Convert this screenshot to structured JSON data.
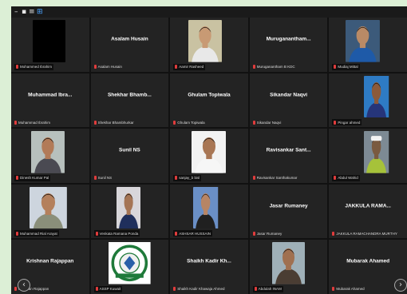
{
  "toolbar": {
    "icons": [
      "minimize-icon",
      "grid-icon",
      "list-icon",
      "gallery-view-icon"
    ]
  },
  "participants": [
    {
      "label": "Mohammed Ibrahim"
    },
    {
      "label": "Asalam Husain",
      "tile_name": "Asalam Husain"
    },
    {
      "label": "Aamir Rasheed"
    },
    {
      "label": "Muruganantham B KDC",
      "tile_name": "Muruganantham..."
    },
    {
      "label": "Mudiaj Mittal"
    },
    {
      "label": "Muhammad Ibrahim",
      "tile_name": "Muhammad Ibra..."
    },
    {
      "label": "Shekhar Bhambhurkar",
      "tile_name": "Shekhar Bhamb..."
    },
    {
      "label": "Ghulam Topiwala",
      "tile_name": "Ghulam Topiwala"
    },
    {
      "label": "Sikandar Naqvi",
      "tile_name": "Sikandar Naqvi"
    },
    {
      "label": "Pingar ahmed"
    },
    {
      "label": "Dinesh Kumar Pal"
    },
    {
      "label": "Sunil NS",
      "tile_name": "Sunil NS"
    },
    {
      "label": "sanjay_b bisl"
    },
    {
      "label": "Ravisankar Santhakumar",
      "tile_name": "Ravisankar Sant..."
    },
    {
      "label": "Abdul Wahid"
    },
    {
      "label": "Muhammad Rial Arayat"
    },
    {
      "label": "Venkata Ramana Ponda"
    },
    {
      "label": "ASHSAR HUSSAIN"
    },
    {
      "label": "Jasar Rumaney",
      "tile_name": "Jasar Rumaney"
    },
    {
      "label": "JAKKULA RAMACHANDRA MURTHY",
      "tile_name": "JAKKULA RAMA..."
    },
    {
      "label": "Krishnan Rajappan",
      "tile_name": "Krishnan Rajappan"
    },
    {
      "label": "ASSP Kuwait"
    },
    {
      "label": "Shaikh Kadir Khawaja Ahmed",
      "tile_name": "Shaikh Kadir Kh..."
    },
    {
      "label": "Abdulah INAM"
    },
    {
      "label": "Mubarak Ahamed",
      "tile_name": "Mubarak Ahamed"
    }
  ],
  "logo_text": "AMERICAN SOCIETY OF SAFETY PROFESSIONALS — KUWAIT — ISO 9001 CERTIFIED",
  "nav": {
    "prev_icon": "chevron-left-icon",
    "next_icon": "chevron-right-icon",
    "prev_symbol": "‹",
    "next_symbol": "›"
  },
  "colors": {
    "tile_bg": "#232323",
    "muted_mic": "#e03c3c",
    "page_bg": "#dcefd6"
  }
}
